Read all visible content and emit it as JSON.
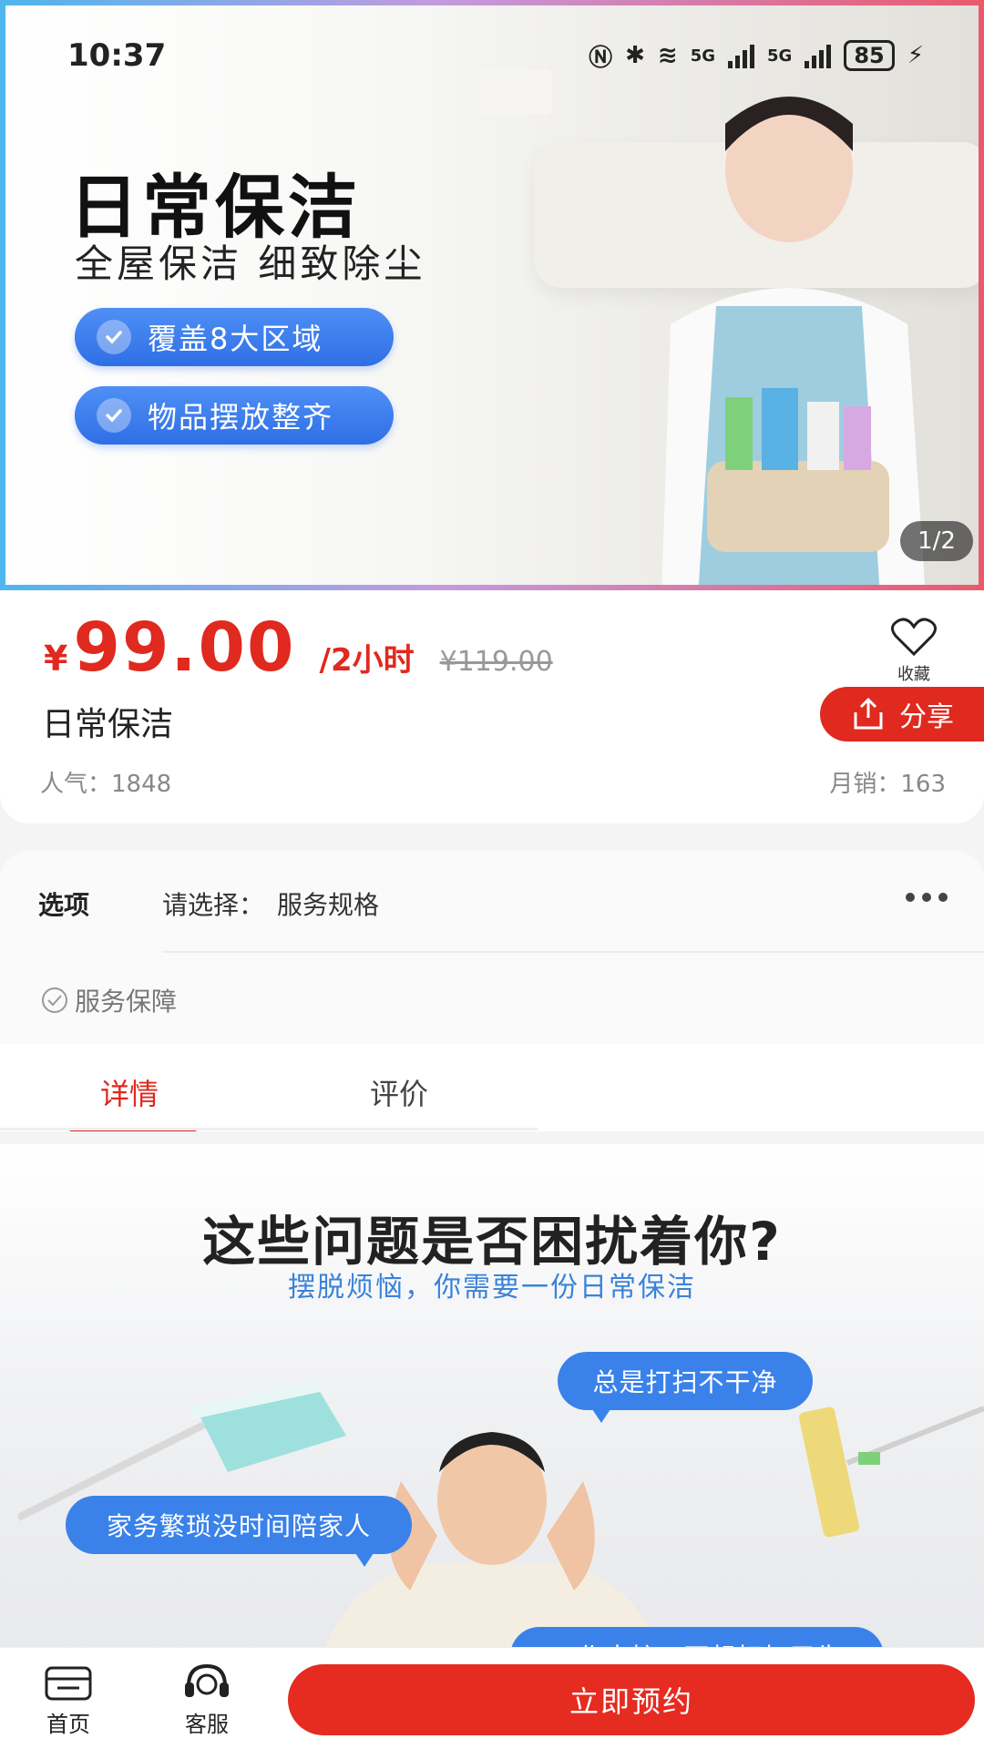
{
  "status_bar": {
    "time": "10:37",
    "network1": "5G",
    "network2": "5G",
    "battery": "85"
  },
  "hero": {
    "title": "日常保洁",
    "subtitle": "全屋保洁 细致除尘",
    "badges": [
      "覆盖8大区域",
      "物品摆放整齐"
    ],
    "image_counter": "1/2"
  },
  "product": {
    "currency": "¥",
    "price": "99.00",
    "unit": "/2小时",
    "original_price": "¥119.00",
    "favorite_label": "收藏",
    "share_label": "分享",
    "name": "日常保洁",
    "popularity": "人气：1848",
    "monthly_sales": "月销：163"
  },
  "options": {
    "label": "选项",
    "select_prompt": "请选择：",
    "select_value": "服务规格",
    "guarantee": "服务保障"
  },
  "tabs": [
    {
      "label": "详情",
      "active": true
    },
    {
      "label": "评价",
      "active": false
    }
  ],
  "detail": {
    "title": "这些问题是否困扰着你?",
    "subtitle": "摆脱烦恼，你需要一份日常保洁",
    "bubbles": [
      "总是打扫不干净",
      "家务繁琐没时间陪家人",
      "工作太忙，不想打扫卫生"
    ]
  },
  "bottom_bar": {
    "home_label": "首页",
    "service_label": "客服",
    "book_label": "立即预约"
  },
  "colors": {
    "accent_red": "#e0291f",
    "badge_blue": "#3a82ea"
  }
}
